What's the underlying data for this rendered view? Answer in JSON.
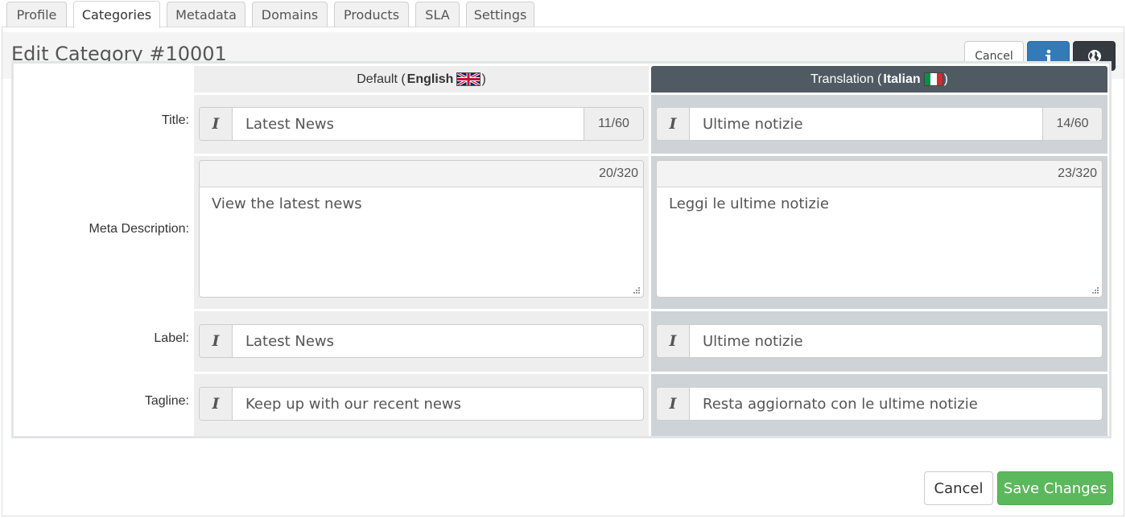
{
  "tabs": [
    {
      "label": "Profile"
    },
    {
      "label": "Categories",
      "active": true
    },
    {
      "label": "Metadata"
    },
    {
      "label": "Domains"
    },
    {
      "label": "Products"
    },
    {
      "label": "SLA"
    },
    {
      "label": "Settings"
    }
  ],
  "header": {
    "title": "Edit Category #10001",
    "cancel_label": "Cancel",
    "info_icon": "info-icon",
    "globe_icon": "globe-icon"
  },
  "columns": {
    "default": {
      "prefix": "Default (",
      "language": "English",
      "suffix": ")",
      "flag": "uk-flag-icon"
    },
    "translation": {
      "prefix": "Translation (",
      "language": "Italian",
      "suffix": ")",
      "flag": "italy-flag-icon"
    }
  },
  "fields": {
    "title": {
      "label": "Title:",
      "default_value": "Latest News",
      "default_count": "11/60",
      "translation_value": "Ultime notizie",
      "translation_count": "14/60"
    },
    "meta_description": {
      "label": "Meta Description:",
      "default_value": "View the latest news",
      "default_count": "20/320",
      "translation_value": "Leggi le ultime notizie",
      "translation_count": "23/320"
    },
    "label": {
      "label": "Label:",
      "default_value": "Latest News",
      "translation_value": "Ultime notizie"
    },
    "tagline": {
      "label": "Tagline:",
      "default_value": "Keep up with our recent news",
      "translation_value": "Resta aggiornato con le ultime notizie"
    }
  },
  "italic_addon": "I",
  "footer": {
    "cancel_label": "Cancel",
    "save_label": "Save Changes"
  },
  "colors": {
    "info_button": "#337ab7",
    "globe_button": "#343a40",
    "save_button": "#5cb85c",
    "translation_header": "#4f5a63",
    "translation_cell": "#cdd3d7"
  }
}
